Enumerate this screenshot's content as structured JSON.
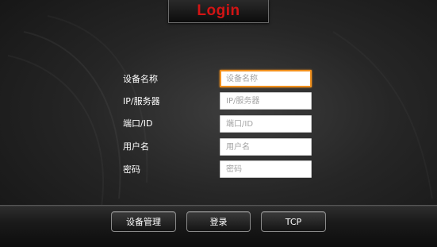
{
  "header": {
    "title": "Login"
  },
  "form": {
    "rows": [
      {
        "label": "设备名称",
        "placeholder": "设备名称",
        "value": ""
      },
      {
        "label": "IP/服务器",
        "placeholder": "IP/服务器",
        "value": ""
      },
      {
        "label": "端口/ID",
        "placeholder": "端口/ID",
        "value": ""
      },
      {
        "label": "用户名",
        "placeholder": "用户名",
        "value": ""
      },
      {
        "label": "密码",
        "placeholder": "密码",
        "value": ""
      }
    ]
  },
  "toolbar": {
    "device_manage_label": "设备管理",
    "login_label": "登录",
    "tcp_label": "TCP"
  },
  "colors": {
    "title": "#d21414",
    "focus_border": "#f0901e",
    "background": "#262626"
  }
}
